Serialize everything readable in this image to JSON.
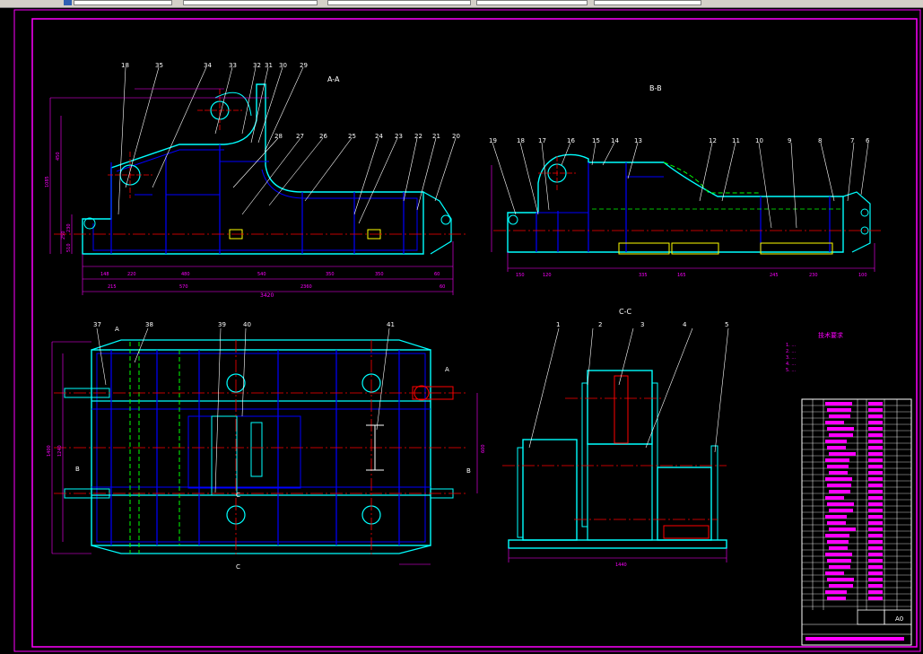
{
  "colors": {
    "background": "#000000",
    "frame": "#ff00ff",
    "outline": "#00ffff",
    "detail": "#0000ff",
    "centerline": "#ff0000",
    "dimension": "#ff00ff",
    "hidden": "#00ff00",
    "text": "#ffffff",
    "weld": "#ffff00"
  },
  "toolbar": {
    "field_values": [
      "",
      "",
      "",
      "",
      ""
    ]
  },
  "views": {
    "aa": "A-A",
    "bb": "B-B",
    "cc": "C-C"
  },
  "section_marks": [
    "A",
    "A",
    "B",
    "B",
    "C",
    "C"
  ],
  "balloons": {
    "aa_top": [
      "18",
      "35",
      "34",
      "33",
      "32",
      "31",
      "30",
      "29"
    ],
    "aa_mid": [
      "28",
      "27",
      "26",
      "25",
      "24",
      "23",
      "22",
      "21",
      "20"
    ],
    "bb_top": [
      "19",
      "18",
      "17",
      "16",
      "15",
      "14",
      "13",
      "12",
      "11",
      "10",
      "9",
      "8",
      "7",
      "6"
    ],
    "cc_top": [
      "1",
      "2",
      "3",
      "4",
      "5"
    ],
    "plan_top": [
      "37",
      "38",
      "39",
      "40",
      "41"
    ]
  },
  "dimensions": {
    "aa_overall": "3420",
    "aa_bottom_chain": [
      "148",
      "220",
      "480",
      "540",
      "350",
      "350",
      "60"
    ],
    "aa_lower_chain": [
      "215",
      "570",
      "2360",
      "60"
    ],
    "aa_left": [
      "1085",
      "450",
      "230",
      "250",
      "510"
    ],
    "bb_chain": [
      "150",
      "120",
      "335",
      "165",
      "245",
      "230",
      "100"
    ],
    "cc_width": "1440",
    "plan_left": [
      "1400",
      "1240"
    ],
    "plan_right": "600"
  },
  "notes": {
    "title": "技术要求",
    "lines": [
      "1. ...",
      "2. ...",
      "3. ...",
      "4. ...",
      "5. ..."
    ]
  },
  "title_block": {
    "sheet_size": "A0"
  }
}
